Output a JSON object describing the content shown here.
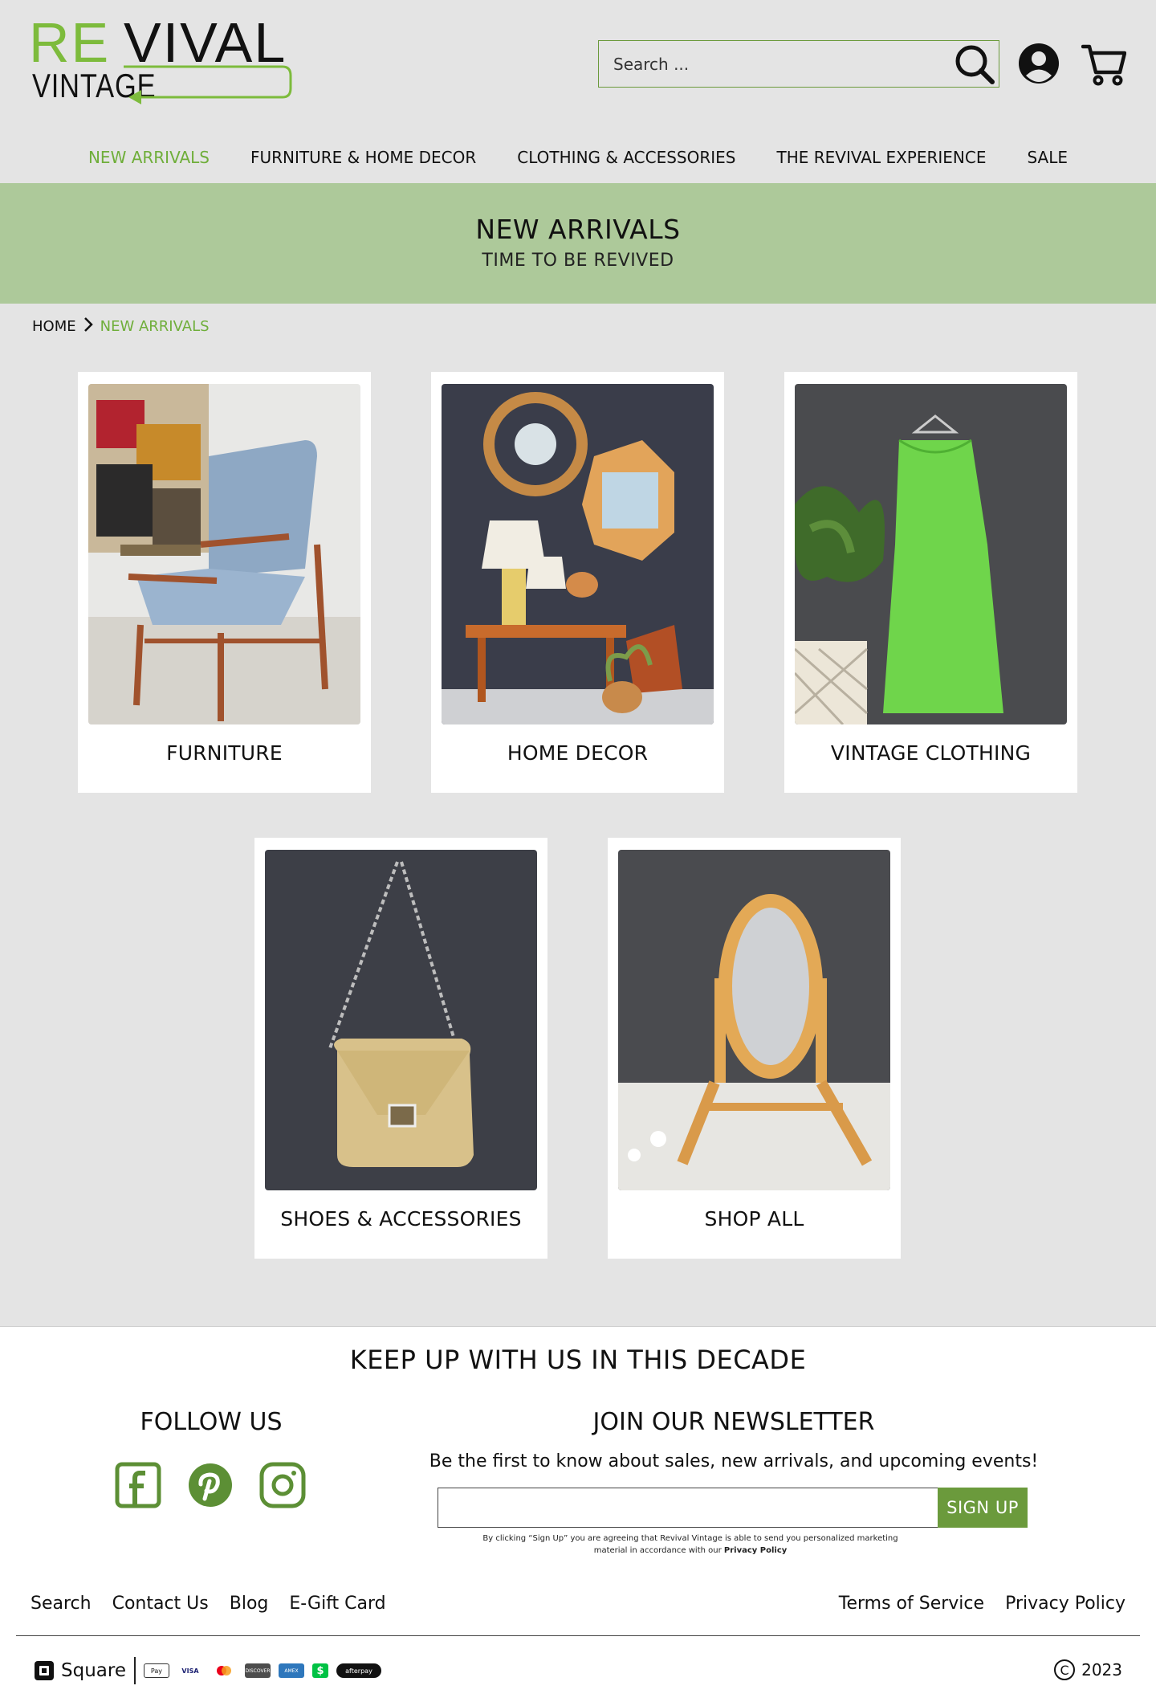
{
  "brand": {
    "logo_part1": "RE",
    "logo_part2": "VIVAL",
    "logo_part3": "VINTAGE",
    "accent_color": "#7dbb3c",
    "hero_color": "#adc99a"
  },
  "header": {
    "search_placeholder": "Search ...",
    "icons": [
      "search-icon",
      "account-icon",
      "cart-icon"
    ]
  },
  "nav": {
    "items": [
      {
        "label": "NEW ARRIVALS",
        "active": true
      },
      {
        "label": "FURNITURE & HOME DECOR",
        "active": false
      },
      {
        "label": "CLOTHING & ACCESSORIES",
        "active": false
      },
      {
        "label": "THE REVIVAL EXPERIENCE",
        "active": false
      },
      {
        "label": "SALE",
        "active": false
      }
    ]
  },
  "hero": {
    "title": "NEW ARRIVALS",
    "subtitle": "TIME TO BE REVIVED"
  },
  "breadcrumb": {
    "home": "HOME",
    "current": "NEW ARRIVALS"
  },
  "categories": [
    {
      "label": "FURNITURE"
    },
    {
      "label": "HOME DECOR"
    },
    {
      "label": "VINTAGE CLOTHING"
    },
    {
      "label": "SHOES & ACCESSORIES"
    },
    {
      "label": "SHOP ALL"
    }
  ],
  "footer": {
    "heading": "KEEP UP WITH US IN THIS DECADE",
    "follow_title": "FOLLOW US",
    "social_icons": [
      "facebook-icon",
      "pinterest-icon",
      "instagram-icon"
    ],
    "newsletter_title": "JOIN OUR NEWSLETTER",
    "newsletter_sub": "Be the first to know about sales, new arrivals, and upcoming events!",
    "signup_label": "SIGN UP",
    "disclaimer_text": "By clicking “Sign Up” you are agreeing that Revival Vintage is able to send you personalized marketing material in accordance with our ",
    "disclaimer_link": "Privacy Policy",
    "links_left": [
      "Search",
      "Contact Us",
      "Blog",
      "E-Gift Card"
    ],
    "links_right": [
      "Terms of Service",
      "Privacy Policy"
    ],
    "square_label": "Square",
    "payment_badges": [
      "Pay",
      "VISA",
      "",
      "DISCOVER",
      "AMEX",
      "$",
      "afterpay"
    ],
    "copyright_symbol": "C",
    "copyright_year": "2023"
  }
}
